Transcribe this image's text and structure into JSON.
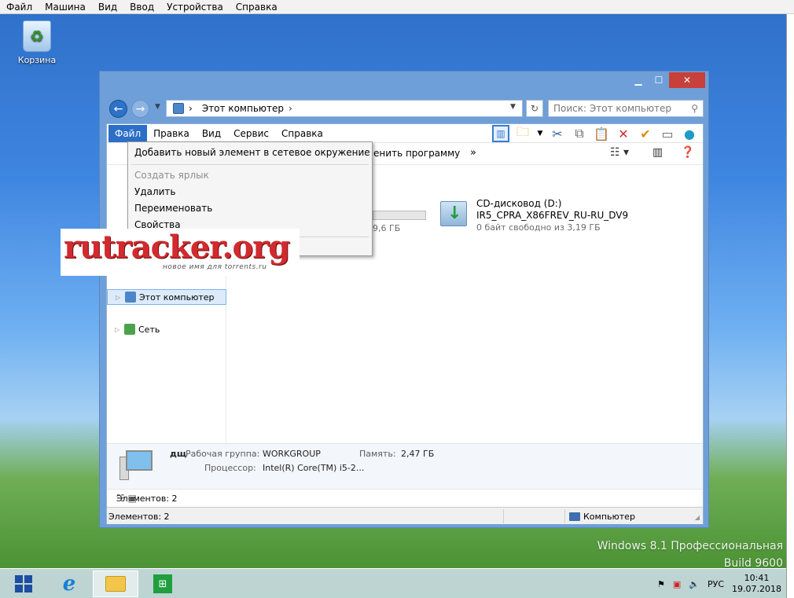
{
  "host_menu": [
    "Файл",
    "Машина",
    "Вид",
    "Ввод",
    "Устройства",
    "Справка"
  ],
  "desktop": {
    "recycle_label": "Корзина",
    "watermark_line1": "Windows 8.1 Профессиональная",
    "watermark_line2": "Build 9600"
  },
  "window": {
    "address": {
      "location": "Этот компьютер"
    },
    "search_placeholder": "Поиск: Этот компьютер",
    "menu": [
      "Файл",
      "Правка",
      "Вид",
      "Сервис",
      "Справка"
    ],
    "command_bar": {
      "change_program": "менить программу",
      "more": "»"
    },
    "nav": {
      "this_pc": "Этот компьютер",
      "network": "Сеть"
    },
    "drive_frag": {
      "size_text": "9,6 ГБ"
    },
    "drive": {
      "name": "CD-дисковод (D:)",
      "label": "IR5_CPRA_X86FREV_RU-RU_DV9",
      "free": "0 байт свободно из 3,19 ГБ"
    },
    "details": {
      "pc_name": "дщ",
      "workgroup_label": "Рабочая группа:",
      "workgroup_value": "WORKGROUP",
      "memory_label": "Память:",
      "memory_value": "2,47 ГБ",
      "cpu_label": "Процессор:",
      "cpu_value": "Intel(R) Core(TM) i5-2..."
    },
    "items_count": "Элементов: 2",
    "statusbar": {
      "left": "Элементов: 2",
      "right": "Компьютер"
    }
  },
  "file_menu": {
    "add_network": "Добавить новый элемент в сетевое окружение",
    "create_shortcut": "Создать ярлык",
    "delete": "Удалить",
    "rename": "Переименовать",
    "properties": "Свойства"
  },
  "logo": {
    "text": "rutracker.org",
    "tagline": "новое имя для torrents.ru"
  },
  "taskbar": {
    "lang": "РУС",
    "time": "10:41",
    "date": "19.07.2018"
  }
}
